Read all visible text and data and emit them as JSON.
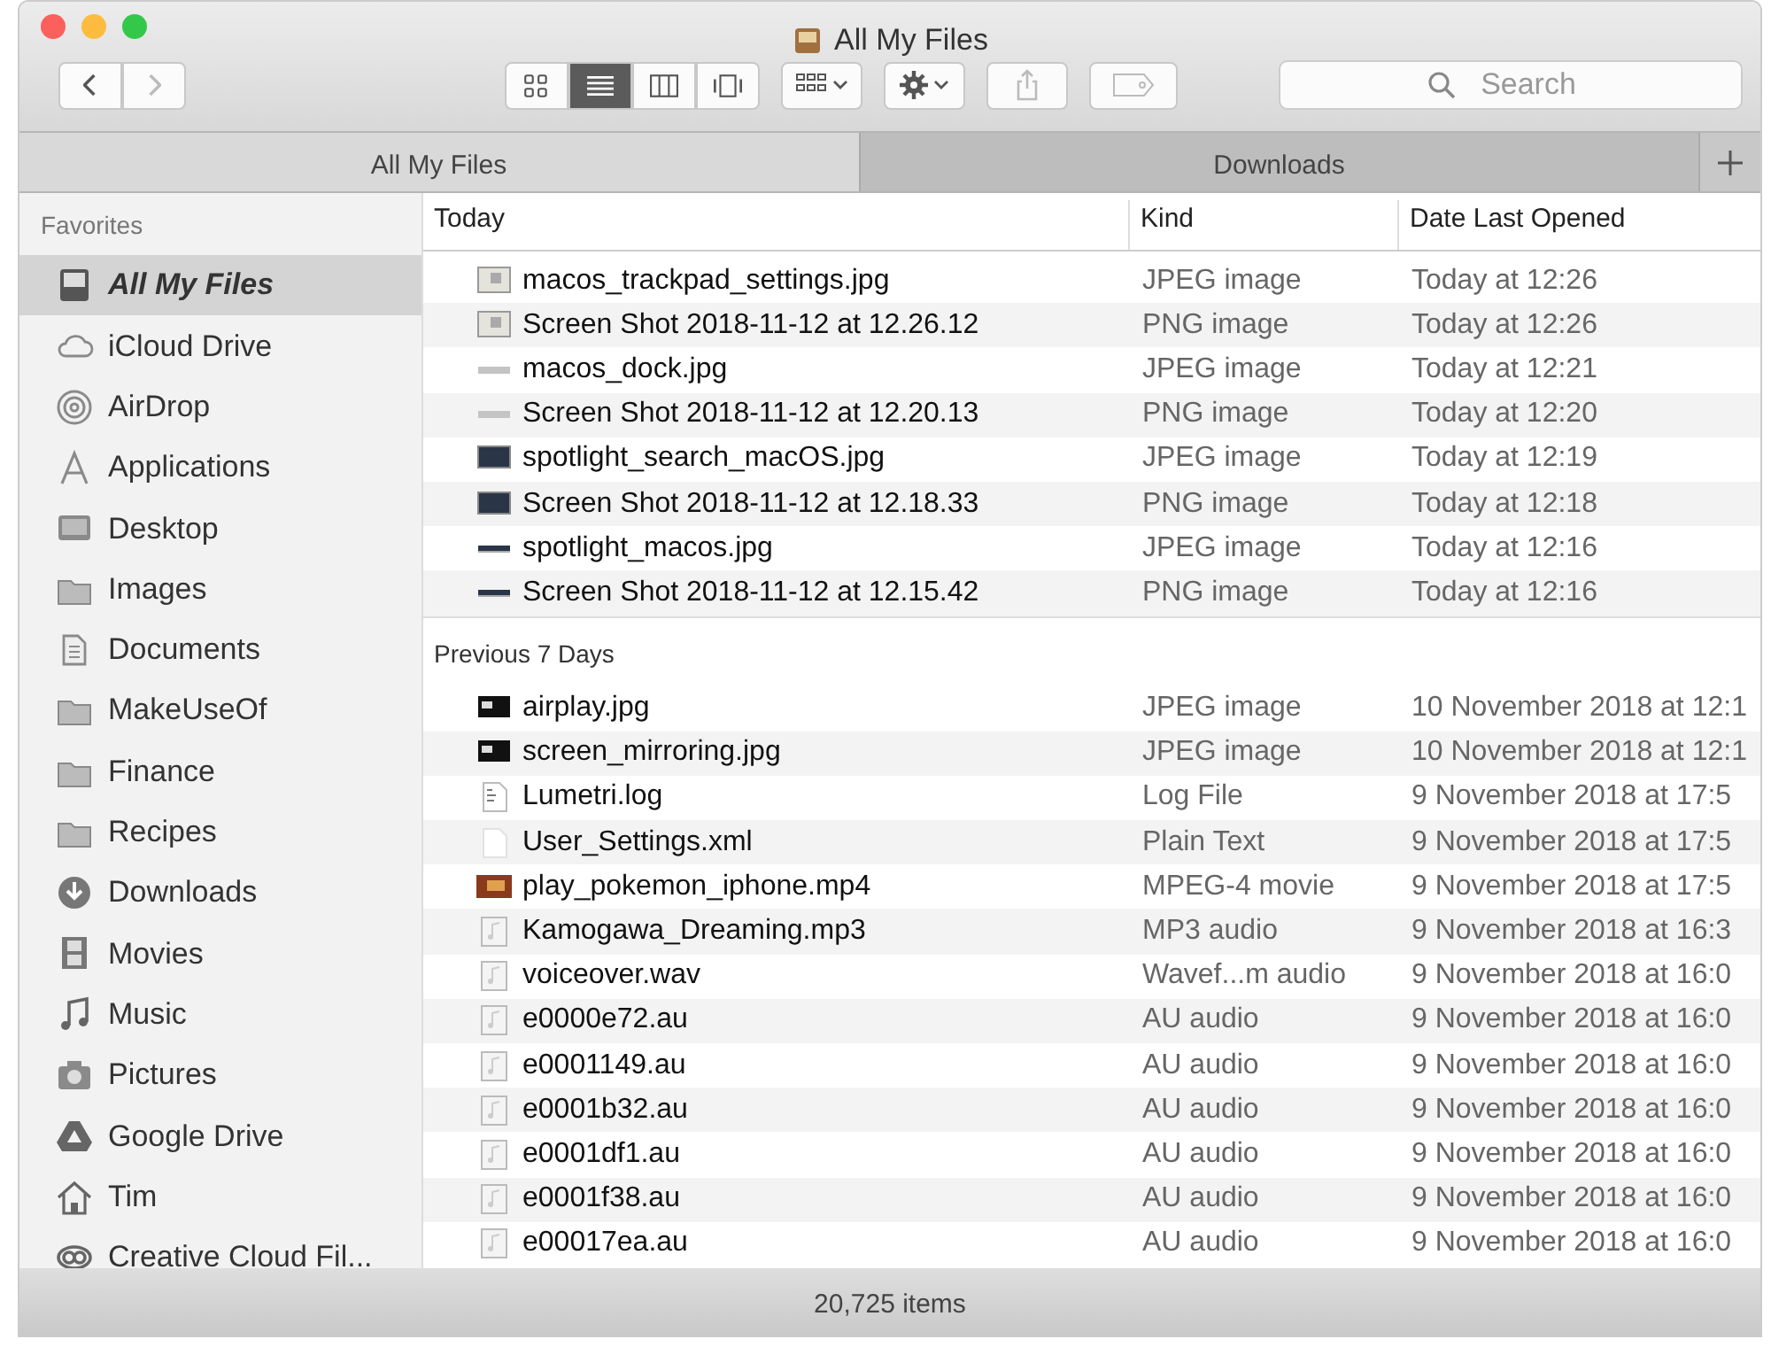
{
  "window": {
    "title": "All My Files"
  },
  "navigation": [
    {
      "kind": "back",
      "disabled": false
    },
    {
      "kind": "forward",
      "disabled": true
    }
  ],
  "view_modes": [
    {
      "kind": "icons",
      "selected": false
    },
    {
      "kind": "list",
      "selected": true
    },
    {
      "kind": "columns",
      "selected": false
    },
    {
      "kind": "coverflow",
      "selected": false
    }
  ],
  "actions": [
    {
      "kind": "arrange",
      "disabled": false
    },
    {
      "kind": "action",
      "disabled": false
    },
    {
      "kind": "share",
      "disabled": true
    },
    {
      "kind": "tags",
      "disabled": true
    }
  ],
  "search": {
    "placeholder": "Search"
  },
  "tabs": [
    {
      "label": "All My Files",
      "selected": true
    },
    {
      "label": "Downloads",
      "selected": false
    }
  ],
  "sidebar": {
    "heading": "Favorites",
    "items": [
      {
        "label": "All My Files",
        "kind": "drive",
        "selected": true
      },
      {
        "label": "iCloud Drive",
        "kind": "cloud",
        "selected": false
      },
      {
        "label": "AirDrop",
        "kind": "airdrop",
        "selected": false
      },
      {
        "label": "Applications",
        "kind": "apps",
        "selected": false
      },
      {
        "label": "Desktop",
        "kind": "desktop",
        "selected": false
      },
      {
        "label": "Images",
        "kind": "folder",
        "selected": false
      },
      {
        "label": "Documents",
        "kind": "documents",
        "selected": false
      },
      {
        "label": "MakeUseOf",
        "kind": "folder",
        "selected": false
      },
      {
        "label": "Finance",
        "kind": "folder",
        "selected": false
      },
      {
        "label": "Recipes",
        "kind": "folder",
        "selected": false
      },
      {
        "label": "Downloads",
        "kind": "downloads",
        "selected": false
      },
      {
        "label": "Movies",
        "kind": "movies",
        "selected": false
      },
      {
        "label": "Music",
        "kind": "music",
        "selected": false
      },
      {
        "label": "Pictures",
        "kind": "pictures",
        "selected": false
      },
      {
        "label": "Google Drive",
        "kind": "gdrive",
        "selected": false
      },
      {
        "label": "Tim",
        "kind": "home",
        "selected": false
      },
      {
        "label": "Creative Cloud Fil...",
        "kind": "cc",
        "selected": false
      }
    ]
  },
  "columns": [
    "Kind",
    "Date Last Opened"
  ],
  "groups": [
    {
      "label": "Today",
      "rows": [
        {
          "name": "macos_trackpad_settings.jpg",
          "kind_text": "JPEG image",
          "date": "Today at 12:26",
          "kind": "light"
        },
        {
          "name": "Screen Shot 2018-11-12 at 12.26.12",
          "kind_text": "PNG image",
          "date": "Today at 12:26",
          "kind": "light"
        },
        {
          "name": "macos_dock.jpg",
          "kind_text": "JPEG image",
          "date": "Today at 12:21",
          "kind": "strip"
        },
        {
          "name": "Screen Shot 2018-11-12 at 12.20.13",
          "kind_text": "PNG image",
          "date": "Today at 12:20",
          "kind": "strip"
        },
        {
          "name": "spotlight_search_macOS.jpg",
          "kind_text": "JPEG image",
          "date": "Today at 12:19",
          "kind": "screen"
        },
        {
          "name": "Screen Shot 2018-11-12 at 12.18.33",
          "kind_text": "PNG image",
          "date": "Today at 12:18",
          "kind": "screen"
        },
        {
          "name": "spotlight_macos.jpg",
          "kind_text": "JPEG image",
          "date": "Today at 12:16",
          "kind": "bar"
        },
        {
          "name": "Screen Shot 2018-11-12 at 12.15.42",
          "kind_text": "PNG image",
          "date": "Today at 12:16",
          "kind": "bar"
        }
      ]
    },
    {
      "label": "Previous 7 Days",
      "rows": [
        {
          "name": "airplay.jpg",
          "kind_text": "JPEG image",
          "date": "10 November 2018 at 12:1",
          "kind": "dark"
        },
        {
          "name": "screen_mirroring.jpg",
          "kind_text": "JPEG image",
          "date": "10 November 2018 at 12:1",
          "kind": "dark"
        },
        {
          "name": "Lumetri.log",
          "kind_text": "Log File",
          "date": "9 November 2018 at 17:5",
          "kind": "log"
        },
        {
          "name": "User_Settings.xml",
          "kind_text": "Plain Text",
          "date": "9 November 2018 at 17:5",
          "kind": "text"
        },
        {
          "name": "play_pokemon_iphone.mp4",
          "kind_text": "MPEG-4 movie",
          "date": "9 November 2018 at 17:5",
          "kind": "movie"
        },
        {
          "name": "Kamogawa_Dreaming.mp3",
          "kind_text": "MP3 audio",
          "date": "9 November 2018 at 16:3",
          "kind": "audio"
        },
        {
          "name": "voiceover.wav",
          "kind_text": "Wavef...m audio",
          "date": "9 November 2018 at 16:0",
          "kind": "audio"
        },
        {
          "name": "e0000e72.au",
          "kind_text": "AU audio",
          "date": "9 November 2018 at 16:0",
          "kind": "audio"
        },
        {
          "name": "e0001149.au",
          "kind_text": "AU audio",
          "date": "9 November 2018 at 16:0",
          "kind": "audio"
        },
        {
          "name": "e0001b32.au",
          "kind_text": "AU audio",
          "date": "9 November 2018 at 16:0",
          "kind": "audio"
        },
        {
          "name": "e0001df1.au",
          "kind_text": "AU audio",
          "date": "9 November 2018 at 16:0",
          "kind": "audio"
        },
        {
          "name": "e0001f38.au",
          "kind_text": "AU audio",
          "date": "9 November 2018 at 16:0",
          "kind": "audio"
        },
        {
          "name": "e00017ea.au",
          "kind_text": "AU audio",
          "date": "9 November 2018 at 16:0",
          "kind": "audio"
        }
      ]
    }
  ],
  "status_bar": "20,725 items"
}
